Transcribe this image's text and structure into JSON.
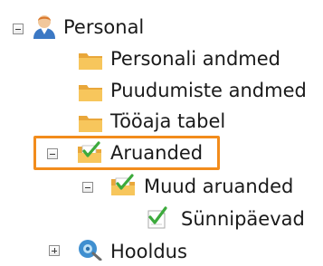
{
  "tree": {
    "personal": {
      "label": "Personal",
      "icon": "user-icon",
      "expanded": true,
      "children": {
        "personali_andmed": {
          "label": "Personali andmed",
          "icon": "folder-icon"
        },
        "puudumiste_andmed": {
          "label": "Puudumiste andmed",
          "icon": "folder-icon"
        },
        "tooaja_tabel": {
          "label": "Tööaja tabel",
          "icon": "folder-icon"
        },
        "aruanded": {
          "label": "Aruanded",
          "icon": "report-folder-icon",
          "expanded": true,
          "highlighted": true,
          "children": {
            "muud_aruanded": {
              "label": "Muud aruanded",
              "icon": "report-folder-icon",
              "expanded": true,
              "children": {
                "sunnipaevad": {
                  "label": "Sünnipäevad",
                  "icon": "report-icon"
                }
              }
            }
          }
        }
      }
    },
    "hooldus": {
      "label": "Hooldus",
      "icon": "maintenance-icon",
      "expanded": false
    }
  },
  "colors": {
    "highlight": "#f28c1c",
    "folder": "#f5b94a",
    "check": "#3caa3c"
  }
}
